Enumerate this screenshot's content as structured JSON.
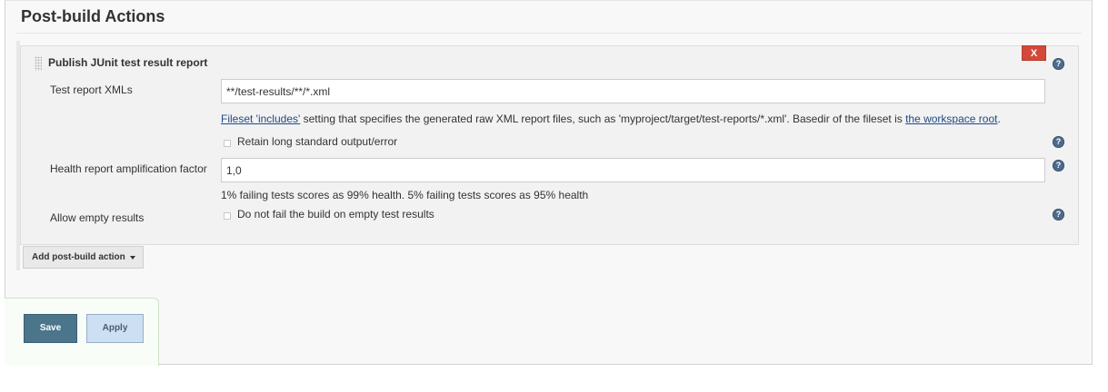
{
  "section": {
    "title": "Post-build Actions"
  },
  "publisher": {
    "title": "Publish JUnit test result report",
    "delete_label": "X",
    "help_glyph": "?",
    "test_report": {
      "label": "Test report XMLs",
      "value": "**/test-results/**/*.xml",
      "desc_link": "Fileset 'includes'",
      "desc_middle": " setting that specifies the generated raw XML report files, such as 'myproject/target/test-reports/*.xml'. Basedir of the fileset is ",
      "desc_link2": "the workspace root",
      "desc_end": "."
    },
    "retain_output": {
      "label": "Retain long standard output/error",
      "checked": false
    },
    "health_factor": {
      "label": "Health report amplification factor",
      "value": "1,0",
      "desc": "1% failing tests scores as 99% health. 5% failing tests scores as 95% health"
    },
    "allow_empty": {
      "label": "Allow empty results",
      "checkbox_label": "Do not fail the build on empty test results",
      "checked": false
    }
  },
  "add_action": {
    "label": "Add post-build action"
  },
  "footer": {
    "save_label": "Save",
    "apply_label": "Apply"
  },
  "colors": {
    "delete_bg": "#d24939",
    "save_bg": "#4b758b",
    "apply_bg": "#cddff2",
    "help_bg": "#4d6b8c",
    "link": "#204a87"
  },
  "icons": {
    "help": "help-icon",
    "delete": "close-icon",
    "dropdown": "caret-down-icon",
    "drag": "drag-handle-icon"
  }
}
